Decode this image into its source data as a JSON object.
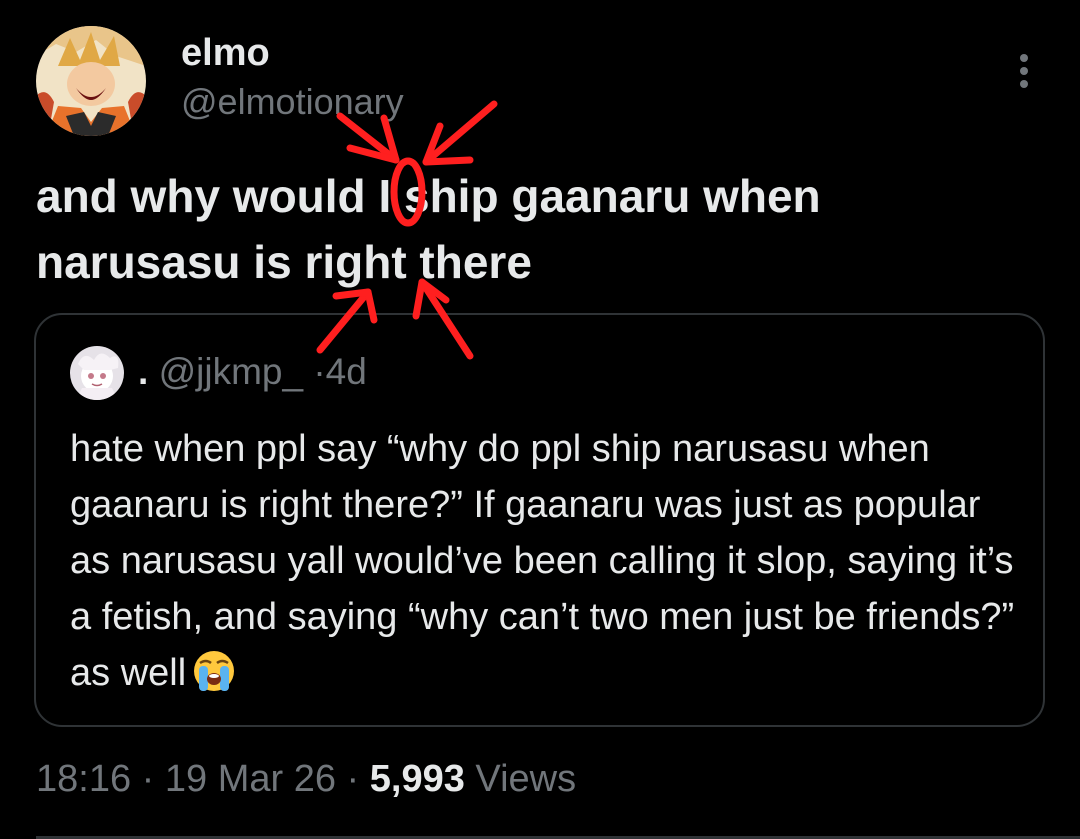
{
  "author": {
    "display_name": "elmo",
    "handle": "@elmotionary",
    "avatar_icon": "anime-avatar-icon"
  },
  "tweet": {
    "text": "and why would I ship gaanaru when narusasu is right there"
  },
  "quote": {
    "display_name": ".",
    "handle": "@jjkmp_",
    "separator": "·",
    "age": "4d",
    "avatar_icon": "anime-avatar-icon",
    "text": "hate when ppl say “why do ppl ship narusasu when gaanaru is right there?” If gaanaru was just as popular as narusasu yall would’ve been calling it slop, saying it’s a fetish, and saying “why can’t two men just be friends?” as well",
    "emoji": "loudly-crying-face-icon"
  },
  "meta": {
    "time": "18:16",
    "date": "19 Mar 26",
    "separator": "·",
    "views_count": "5,993",
    "views_label": "Views"
  },
  "colors": {
    "background": "#000000",
    "primary_text": "#e7e9ea",
    "secondary_text": "#71767b",
    "border": "#2f3336",
    "annotation_red": "#ff1f1f"
  }
}
